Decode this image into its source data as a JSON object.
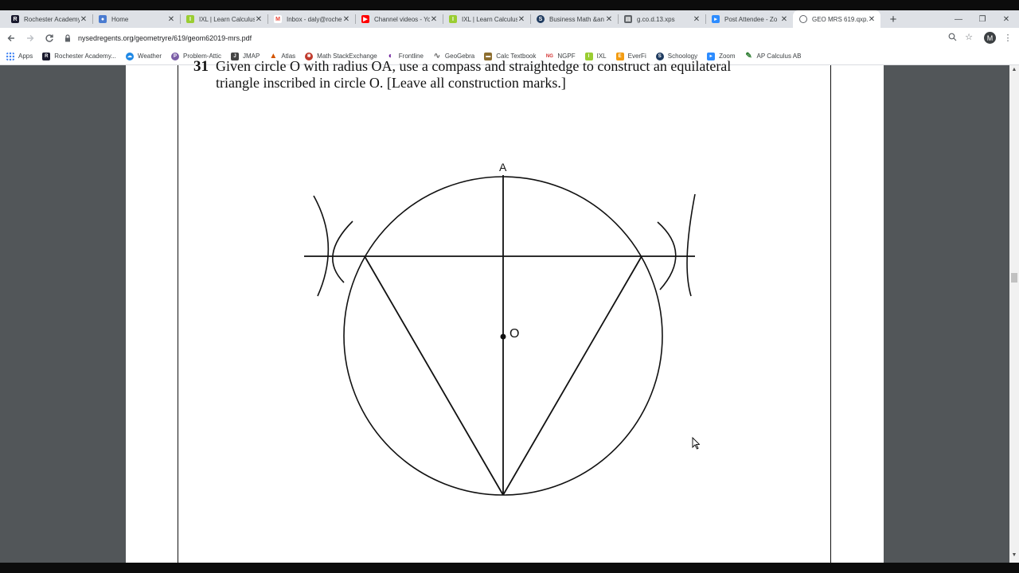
{
  "browser": {
    "tabs": [
      {
        "title": "Rochester Academy",
        "icon": "rochester-icon",
        "color": "#1a1a2e"
      },
      {
        "title": "Home",
        "icon": "globe-icon",
        "color": "#4a7bd0"
      },
      {
        "title": "IXL | Learn Calculus",
        "icon": "ixl-icon",
        "color": "#9acd32"
      },
      {
        "title": "Inbox - daly@roche",
        "icon": "gmail-icon",
        "color": "#ea4335"
      },
      {
        "title": "Channel videos - Yo",
        "icon": "youtube-icon",
        "color": "#ff0000"
      },
      {
        "title": "IXL | Learn Calculus",
        "icon": "ixl-icon",
        "color": "#9acd32"
      },
      {
        "title": "Business Math &an",
        "icon": "schoology-icon",
        "color": "#1e3a5f"
      },
      {
        "title": "g.co.d.13.xps",
        "icon": "document-icon",
        "color": "#5f6368"
      },
      {
        "title": "Post Attendee - Zo",
        "icon": "zoom-icon",
        "color": "#2d8cff"
      },
      {
        "title": "GEO MRS 619.qxp...",
        "icon": "globe-icon",
        "color": "#5f6368"
      }
    ],
    "new_tab": "+",
    "url": "nysedregents.org/geometryre/619/geom62019-mrs.pdf",
    "avatar_letter": "M",
    "bookmarks": [
      {
        "label": "Apps",
        "icon": "apps-grid-icon",
        "color": "#4285f4"
      },
      {
        "label": "Rochester Academy...",
        "icon": "rochester-icon",
        "color": "#1a1a2e"
      },
      {
        "label": "Weather",
        "icon": "weather-icon",
        "color": "#1e88e5"
      },
      {
        "label": "Problem-Attic",
        "icon": "problem-attic-icon",
        "color": "#7b5ea7"
      },
      {
        "label": "JMAP",
        "icon": "jmap-icon",
        "color": "#444444"
      },
      {
        "label": "Atlas",
        "icon": "atlas-icon",
        "color": "#d35400"
      },
      {
        "label": "Math StackExchange",
        "icon": "stackexchange-icon",
        "color": "#c0392b"
      },
      {
        "label": "Frontline",
        "icon": "frontline-icon",
        "color": "#6a1b9a"
      },
      {
        "label": "GeoGebra",
        "icon": "geogebra-icon",
        "color": "#666666"
      },
      {
        "label": "Calc Textbook",
        "icon": "textbook-icon",
        "color": "#8d6e2f"
      },
      {
        "label": "NGPF",
        "icon": "ngpf-icon",
        "color": "#d32f2f"
      },
      {
        "label": "IXL",
        "icon": "ixl-icon",
        "color": "#9acd32"
      },
      {
        "label": "EverFi",
        "icon": "everfi-icon",
        "color": "#f39c12"
      },
      {
        "label": "Schoology",
        "icon": "schoology-icon",
        "color": "#1e3a5f"
      },
      {
        "label": "Zoom",
        "icon": "zoom-icon",
        "color": "#2d8cff"
      },
      {
        "label": "AP Calculus AB",
        "icon": "ap-icon",
        "color": "#2e7d32"
      }
    ]
  },
  "document": {
    "question_number": "31",
    "question_line1": "Given circle O with radius OA, use a compass and straightedge to construct an equilateral",
    "question_line2": "triangle inscribed in circle O. [Leave all construction marks.]",
    "label_A": "A",
    "label_O": "O"
  }
}
